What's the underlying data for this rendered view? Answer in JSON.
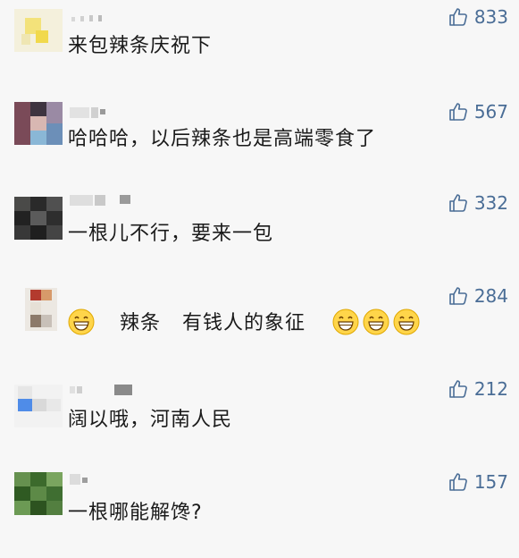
{
  "colors": {
    "background": "#f7f7f7",
    "text": "#1a1a1a",
    "like": "#4a6d96"
  },
  "comments": [
    {
      "text": "来包辣条庆祝下",
      "likes": "833"
    },
    {
      "text": "哈哈哈，以后辣条也是高端零食了",
      "likes": "567"
    },
    {
      "text": "一根儿不行，要来一包",
      "likes": "332"
    },
    {
      "text_part1": "辣条",
      "text_part2": "有钱人的象征",
      "likes": "284",
      "emoji_icon": "grinning-face-icon"
    },
    {
      "text": "阔以哦，河南人民",
      "likes": "212"
    },
    {
      "text": "一根哪能解馋?",
      "likes": "157"
    }
  ]
}
